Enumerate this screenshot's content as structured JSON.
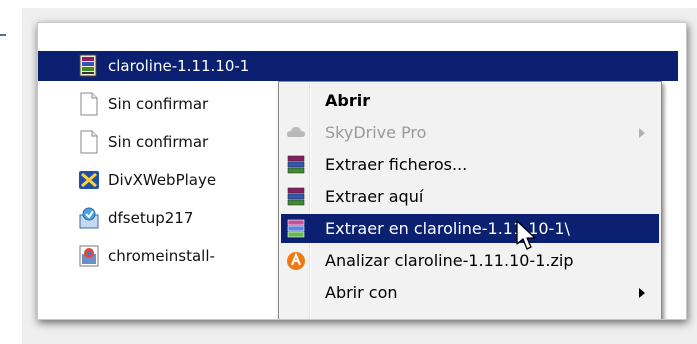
{
  "files": [
    {
      "name": "claroline-1.11.10-1",
      "icon": "archive-icon",
      "selected": true
    },
    {
      "name": "Sin confirmar",
      "icon": "blank-file-icon"
    },
    {
      "name": "Sin confirmar",
      "icon": "blank-file-icon"
    },
    {
      "name": "DivXWebPlaye",
      "icon": "divx-icon"
    },
    {
      "name": "dfsetup217",
      "icon": "installer-icon"
    },
    {
      "name": "chromeinstall-",
      "icon": "chrome-installer-icon"
    }
  ],
  "context_menu": {
    "items": [
      {
        "label": "Abrir",
        "icon": null,
        "bold": true
      },
      {
        "label": "SkyDrive Pro",
        "icon": "skydrive-icon",
        "disabled": true,
        "submenu": true
      },
      {
        "label": "Extraer ficheros...",
        "icon": "winrar-icon"
      },
      {
        "label": "Extraer aquí",
        "icon": "winrar-icon"
      },
      {
        "label": "Extraer en claroline-1.11.10-1\\",
        "icon": "winrar-icon",
        "highlighted": true
      },
      {
        "label": "Analizar claroline-1.11.10-1.zip",
        "icon": "avast-icon"
      },
      {
        "label": "Abrir con",
        "icon": null,
        "submenu": true
      }
    ]
  },
  "colors": {
    "selection": "#0b2070",
    "menu_bg": "#f2f2f2"
  }
}
